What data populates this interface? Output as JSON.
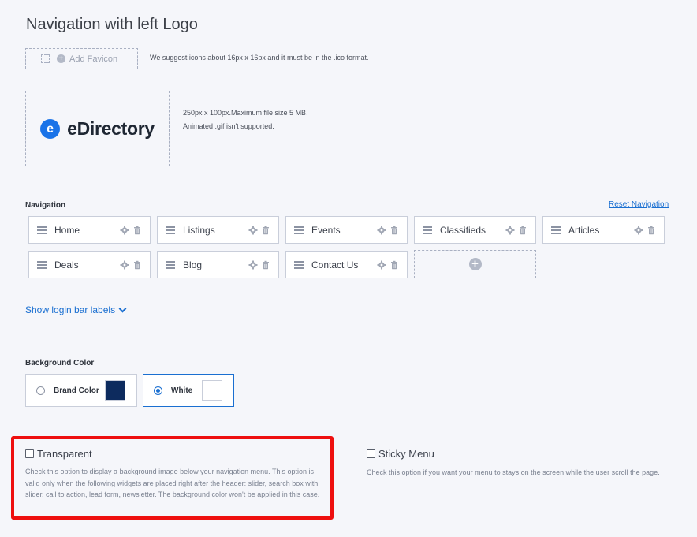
{
  "page": {
    "title": "Navigation with left Logo"
  },
  "favicon": {
    "add_label": "Add Favicon",
    "hint": "We suggest icons about 16px x 16px and it must be in the .ico format."
  },
  "logo": {
    "brand_letter": "e",
    "brand_text": "eDirectory",
    "hint_line1": "250px x 100px.Maximum file size 5 MB.",
    "hint_line2": "Animated .gif isn't supported."
  },
  "navigation": {
    "label": "Navigation",
    "reset_label": "Reset Navigation",
    "items": [
      {
        "label": "Home"
      },
      {
        "label": "Listings"
      },
      {
        "label": "Events"
      },
      {
        "label": "Classifieds"
      },
      {
        "label": "Articles"
      },
      {
        "label": "Deals"
      },
      {
        "label": "Blog"
      },
      {
        "label": "Contact Us"
      }
    ],
    "add_symbol": "+"
  },
  "login_labels": {
    "label": "Show login bar labels"
  },
  "background_color": {
    "label": "Background Color",
    "options": [
      {
        "label": "Brand Color",
        "swatch": "#0d2b5e",
        "selected": false
      },
      {
        "label": "White",
        "swatch": "#ffffff",
        "selected": true
      }
    ]
  },
  "transparent": {
    "label": "Transparent",
    "checked": false,
    "description": "Check this option to display a background image below your navigation menu. This option is valid only when the following widgets are placed right after the header: slider, search box with slider, call to action, lead form, newsletter. The background color won't be applied in this case."
  },
  "sticky_menu": {
    "label": "Sticky Menu",
    "checked": false,
    "description": "Check this option if you want your menu to stays on the screen while the user scroll the page."
  },
  "colors": {
    "accent": "#1a6fd1",
    "highlight": "#ee0f0f"
  }
}
